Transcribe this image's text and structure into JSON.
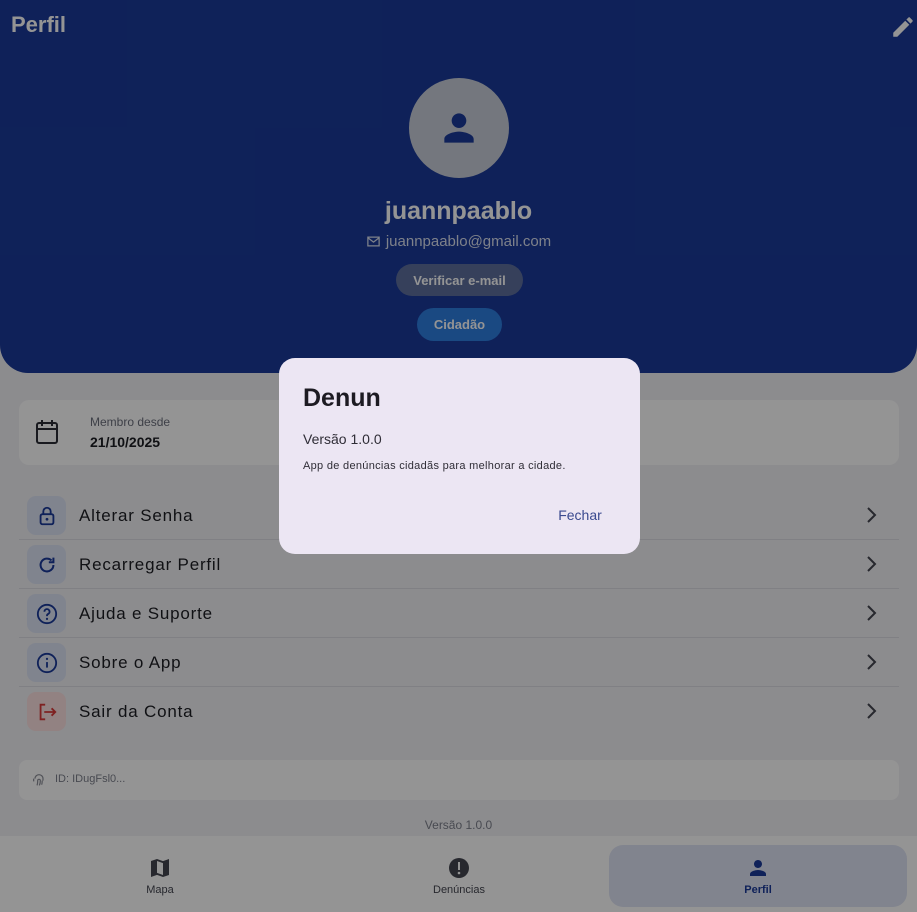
{
  "header": {
    "title": "Perfil",
    "edit_icon": "pencil-icon",
    "username": "juannpaablo",
    "email": "juannpaablo@gmail.com",
    "verify_label": "Verificar e-mail",
    "role": "Cidadão"
  },
  "member": {
    "label": "Membro desde",
    "date": "21/10/2025"
  },
  "menu": {
    "items": [
      {
        "label": "Alterar Senha",
        "icon": "lock-icon"
      },
      {
        "label": "Recarregar Perfil",
        "icon": "refresh-icon"
      },
      {
        "label": "Ajuda e Suporte",
        "icon": "help-icon"
      },
      {
        "label": "Sobre o App",
        "icon": "info-icon"
      },
      {
        "label": "Sair da Conta",
        "icon": "logout-icon"
      }
    ]
  },
  "id_card": {
    "text": "ID: IDugFsl0..."
  },
  "footer": {
    "version": "Versão 1.0.0"
  },
  "nav": {
    "items": [
      {
        "label": "Mapa",
        "icon": "map-icon"
      },
      {
        "label": "Denúncias",
        "icon": "alert-icon"
      },
      {
        "label": "Perfil",
        "icon": "person-icon",
        "active": true
      }
    ]
  },
  "dialog": {
    "title": "Denun",
    "version": "Versão 1.0.0",
    "description": "App de denúncias cidadãs para melhorar a cidade.",
    "close_label": "Fechar"
  },
  "colors": {
    "header_bg": "#1a3a9a",
    "accent_chip": "#2e7ee0",
    "dialog_bg": "#ece6f3",
    "danger": "#d93a3a"
  }
}
